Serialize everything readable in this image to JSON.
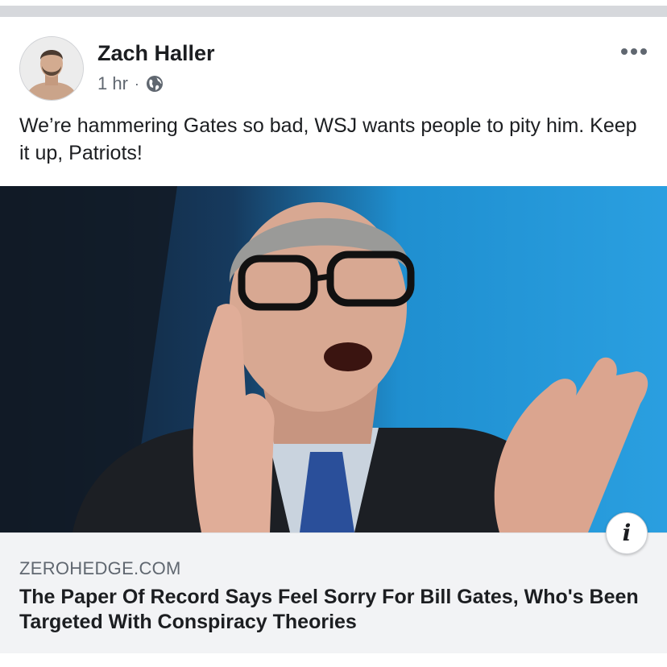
{
  "post": {
    "author": "Zach Haller",
    "time": "1 hr",
    "separator": "·",
    "privacy_icon": "globe-icon",
    "more_icon": "more-options-icon",
    "text": "We’re hammering Gates so bad, WSJ wants people to pity him. Keep it up, Patriots!"
  },
  "link_preview": {
    "domain": "ZEROHEDGE.COM",
    "title": "The Paper Of Record Says Feel Sorry For Bill Gates, Who's Been Targeted With Conspiracy Theories",
    "info_icon": "info-icon",
    "info_glyph": "i"
  },
  "colors": {
    "divider": "#d6d8dc",
    "text_primary": "#1c1e21",
    "text_secondary": "#606770",
    "card_bg": "#f2f3f5",
    "photo_bg_blue": "#1f8fd0"
  }
}
